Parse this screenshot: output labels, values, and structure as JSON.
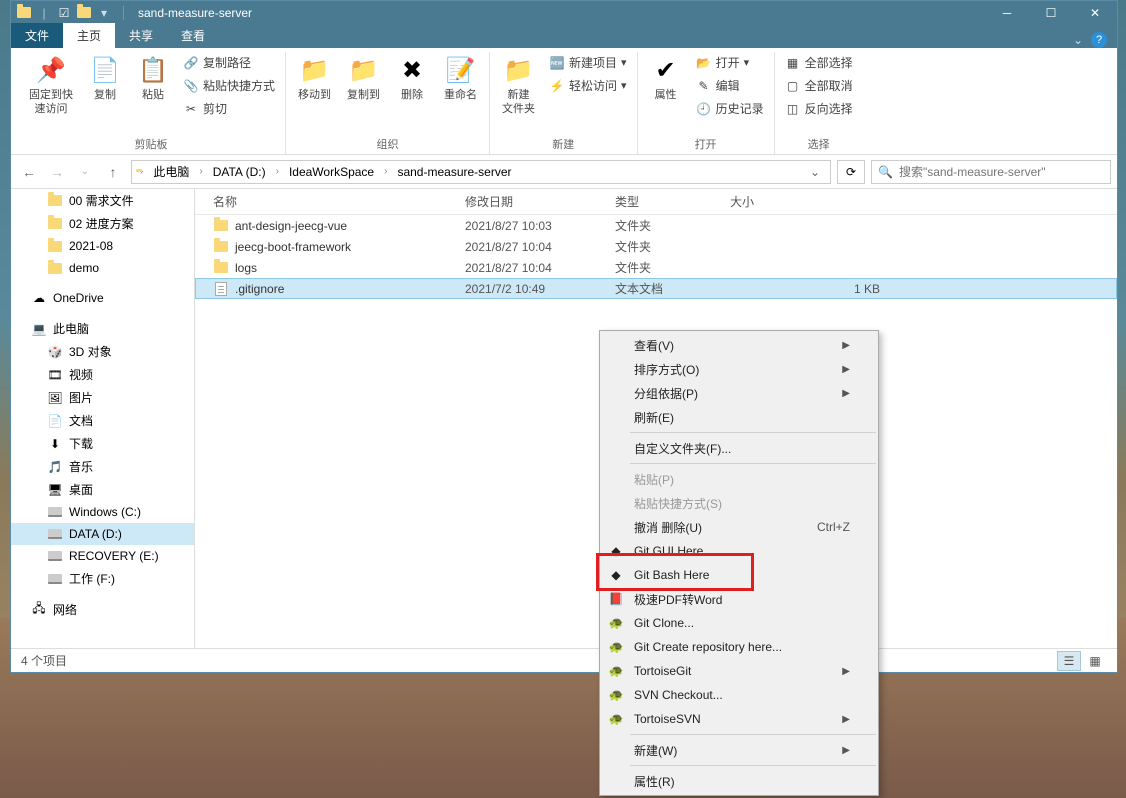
{
  "window": {
    "title": "sand-measure-server"
  },
  "ribbon": {
    "tabs": {
      "file": "文件",
      "home": "主页",
      "share": "共享",
      "view": "查看"
    },
    "groups": {
      "clipboard": {
        "label": "剪贴板",
        "pin": "固定到快\n速访问",
        "copy": "复制",
        "paste": "粘贴",
        "copy_path": "复制路径",
        "paste_shortcut": "粘贴快捷方式",
        "cut": "剪切"
      },
      "organize": {
        "label": "组织",
        "move_to": "移动到",
        "copy_to": "复制到",
        "delete": "删除",
        "rename": "重命名"
      },
      "new": {
        "label": "新建",
        "new_folder": "新建\n文件夹",
        "new_item": "新建项目",
        "easy_access": "轻松访问"
      },
      "open": {
        "label": "打开",
        "properties": "属性",
        "open": "打开",
        "edit": "编辑",
        "history": "历史记录"
      },
      "select": {
        "label": "选择",
        "select_all": "全部选择",
        "select_none": "全部取消",
        "invert": "反向选择"
      }
    }
  },
  "breadcrumb": [
    "此电脑",
    "DATA (D:)",
    "IdeaWorkSpace",
    "sand-measure-server"
  ],
  "search": {
    "placeholder": "搜索\"sand-measure-server\""
  },
  "nav_pane": {
    "quick": [
      {
        "label": "00 需求文件",
        "icon": "folder"
      },
      {
        "label": "02 进度方案",
        "icon": "folder"
      },
      {
        "label": "2021-08",
        "icon": "folder"
      },
      {
        "label": "demo",
        "icon": "folder"
      }
    ],
    "onedrive": "OneDrive",
    "this_pc": "此电脑",
    "pc_items": [
      {
        "label": "3D 对象",
        "icon": "3d"
      },
      {
        "label": "视频",
        "icon": "video"
      },
      {
        "label": "图片",
        "icon": "pictures"
      },
      {
        "label": "文档",
        "icon": "documents"
      },
      {
        "label": "下载",
        "icon": "downloads"
      },
      {
        "label": "音乐",
        "icon": "music"
      },
      {
        "label": "桌面",
        "icon": "desktop"
      },
      {
        "label": "Windows (C:)",
        "icon": "drive"
      },
      {
        "label": "DATA (D:)",
        "icon": "drive",
        "selected": true
      },
      {
        "label": "RECOVERY (E:)",
        "icon": "drive"
      },
      {
        "label": "工作 (F:)",
        "icon": "drive"
      }
    ],
    "network": "网络"
  },
  "columns": {
    "name": "名称",
    "date": "修改日期",
    "type": "类型",
    "size": "大小"
  },
  "files": [
    {
      "name": "ant-design-jeecg-vue",
      "date": "2021/8/27 10:03",
      "type": "文件夹",
      "size": "",
      "icon": "folder"
    },
    {
      "name": "jeecg-boot-framework",
      "date": "2021/8/27 10:04",
      "type": "文件夹",
      "size": "",
      "icon": "folder"
    },
    {
      "name": "logs",
      "date": "2021/8/27 10:04",
      "type": "文件夹",
      "size": "",
      "icon": "folder"
    },
    {
      "name": ".gitignore",
      "date": "2021/7/2 10:49",
      "type": "文本文档",
      "size": "1 KB",
      "icon": "text",
      "selected": true
    }
  ],
  "status": {
    "count": "4 个项目"
  },
  "context_menu": [
    {
      "label": "查看(V)",
      "submenu": true
    },
    {
      "label": "排序方式(O)",
      "submenu": true
    },
    {
      "label": "分组依据(P)",
      "submenu": true
    },
    {
      "label": "刷新(E)"
    },
    {
      "sep": true
    },
    {
      "label": "自定义文件夹(F)..."
    },
    {
      "sep": true
    },
    {
      "label": "粘贴(P)",
      "disabled": true
    },
    {
      "label": "粘贴快捷方式(S)",
      "disabled": true
    },
    {
      "label": "撤消 删除(U)",
      "shortcut": "Ctrl+Z"
    },
    {
      "label": "Git GUI Here",
      "icon": "git"
    },
    {
      "label": "Git Bash Here",
      "icon": "git"
    },
    {
      "label": "极速PDF转Word",
      "icon": "pdf"
    },
    {
      "label": "Git Clone...",
      "icon": "tortoise"
    },
    {
      "label": "Git Create repository here...",
      "icon": "tortoise"
    },
    {
      "label": "TortoiseGit",
      "icon": "tortoise",
      "submenu": true
    },
    {
      "label": "SVN Checkout...",
      "icon": "svn"
    },
    {
      "label": "TortoiseSVN",
      "icon": "svn",
      "submenu": true
    },
    {
      "sep": true
    },
    {
      "label": "新建(W)",
      "submenu": true
    },
    {
      "sep": true
    },
    {
      "label": "属性(R)"
    }
  ]
}
